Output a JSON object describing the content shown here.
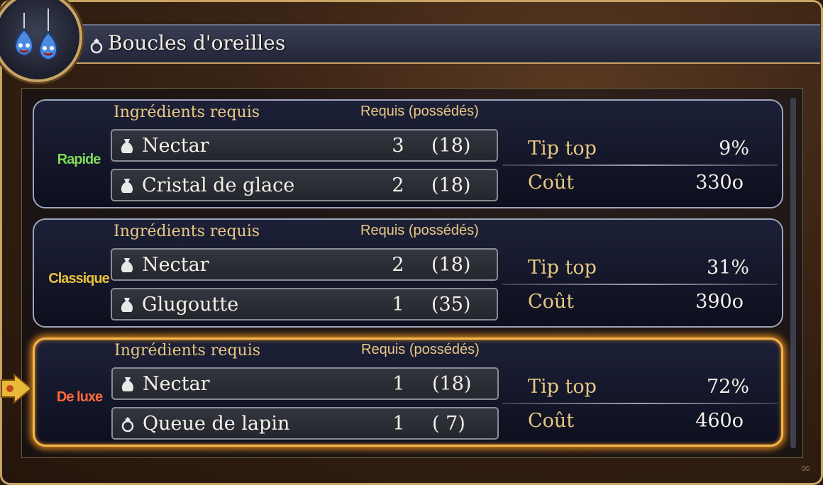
{
  "header": {
    "title": "Boucles d'oreilles",
    "icon": "ring-icon",
    "emblem_icon": "slime-earrings-icon"
  },
  "recipes": [
    {
      "tier": "Rapide",
      "tier_color": "#7ed957",
      "ingredients_header": "Ingrédients requis",
      "req_header": "Requis (possédés)",
      "ingredients": [
        {
          "name": "Nectar",
          "icon": "bag-icon",
          "required": "3",
          "owned": "(18)"
        },
        {
          "name": "Cristal de glace",
          "icon": "bag-icon",
          "required": "2",
          "owned": "(18)"
        }
      ],
      "stat_label": "Tip top",
      "stat_value": "9%",
      "cost_label": "Coût",
      "cost_value": "330o",
      "selected": false
    },
    {
      "tier": "Classique",
      "tier_color": "#e8c23a",
      "ingredients_header": "Ingrédients requis",
      "req_header": "Requis (possédés)",
      "ingredients": [
        {
          "name": "Nectar",
          "icon": "bag-icon",
          "required": "2",
          "owned": "(18)"
        },
        {
          "name": "Glugoutte",
          "icon": "bag-icon",
          "required": "1",
          "owned": "(35)"
        }
      ],
      "stat_label": "Tip top",
      "stat_value": "31%",
      "cost_label": "Coût",
      "cost_value": "390o",
      "selected": false
    },
    {
      "tier": "De luxe",
      "tier_color": "#ff6a3a",
      "ingredients_header": "Ingrédients requis",
      "req_header": "Requis (possédés)",
      "ingredients": [
        {
          "name": "Nectar",
          "icon": "bag-icon",
          "required": "1",
          "owned": "(18)"
        },
        {
          "name": "Queue de lapin",
          "icon": "ring-icon",
          "required": "1",
          "owned": "( 7)"
        }
      ],
      "stat_label": "Tip top",
      "stat_value": "72%",
      "cost_label": "Coût",
      "cost_value": "460o",
      "selected": true
    }
  ],
  "colors": {
    "gold": "#e9c882",
    "frame": "#c9a465",
    "selection": "#f3b74a"
  }
}
